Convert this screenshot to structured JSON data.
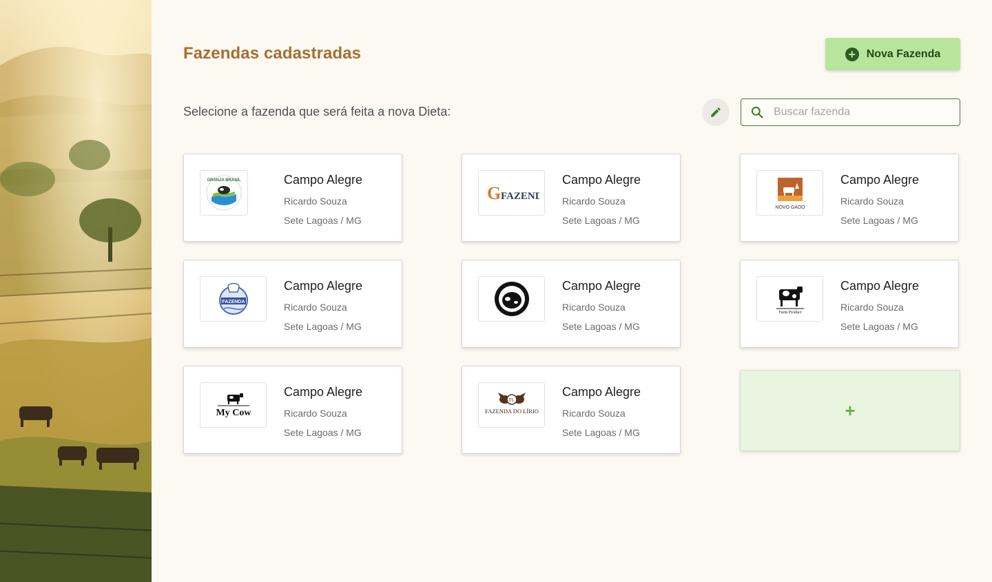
{
  "page": {
    "title": "Fazendas cadastradas",
    "subtitle": "Selecione a fazenda que será feita a nova Dieta:",
    "new_farm_label": "Nova Fazenda",
    "new_farm_icon": "plus-circle-icon",
    "edit_icon": "pencil-icon",
    "add_card_label": "+"
  },
  "search": {
    "placeholder": "Buscar fazenda",
    "value": "",
    "icon": "search-icon"
  },
  "colors": {
    "title": "#a56f30",
    "primary_button": "#b8e59b",
    "primary_dark": "#2f5b22",
    "add_card_bg": "#e9f5e0"
  },
  "farms": [
    {
      "name": "Campo Alegre",
      "owner": "Ricardo Souza",
      "location": "Sete Lagoas / MG",
      "logo": "granja-brasil-logo",
      "logo_text": "GRANJA BRASIL"
    },
    {
      "name": "Campo Alegre",
      "owner": "Ricardo Souza",
      "location": "Sete Lagoas / MG",
      "logo": "fazenda-gobbi-logo",
      "logo_text": "FAZENDA GOBBI"
    },
    {
      "name": "Campo Alegre",
      "owner": "Ricardo Souza",
      "location": "Sete Lagoas / MG",
      "logo": "novo-gado-logo",
      "logo_text": "NOVO GADO"
    },
    {
      "name": "Campo Alegre",
      "owner": "Ricardo Souza",
      "location": "Sete Lagoas / MG",
      "logo": "fazenda-badge-logo",
      "logo_text": "FAZENDA"
    },
    {
      "name": "Campo Alegre",
      "owner": "Ricardo Souza",
      "location": "Sete Lagoas / MG",
      "logo": "cow-stamp-logo",
      "logo_text": ""
    },
    {
      "name": "Campo Alegre",
      "owner": "Ricardo Souza",
      "location": "Sete Lagoas / MG",
      "logo": "farm-product-logo",
      "logo_text": "Farm Product"
    },
    {
      "name": "Campo Alegre",
      "owner": "Ricardo Souza",
      "location": "Sete Lagoas / MG",
      "logo": "my-cow-logo",
      "logo_text": "My Cow"
    },
    {
      "name": "Campo Alegre",
      "owner": "Ricardo Souza",
      "location": "Sete Lagoas / MG",
      "logo": "fazenda-do-lirio-logo",
      "logo_text": "FAZENDA DO LÍRIO"
    }
  ]
}
